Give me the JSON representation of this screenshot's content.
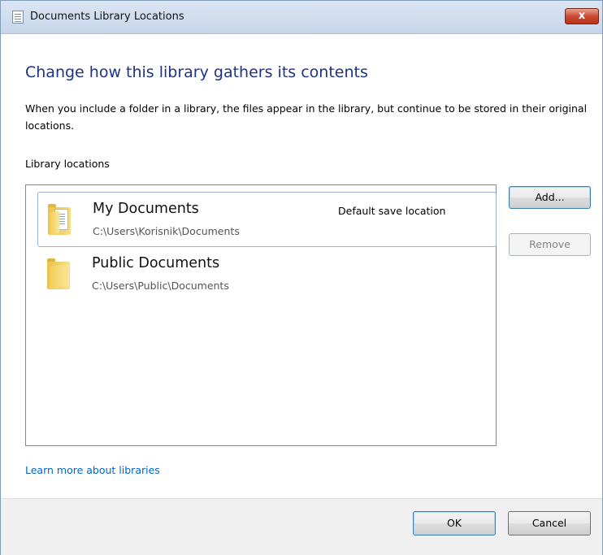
{
  "window": {
    "title": "Documents Library Locations",
    "close_symbol": "x"
  },
  "heading": "Change how this library gathers its contents",
  "description": "When you include a folder in a library, the files appear in the library, but continue to be stored in their original locations.",
  "locations_label": "Library locations",
  "locations": [
    {
      "name": "My Documents",
      "path": "C:\\Users\\Korisnik\\Documents",
      "badge": "Default save location",
      "icon": "documents-folder-icon",
      "selected": true
    },
    {
      "name": "Public Documents",
      "path": "C:\\Users\\Public\\Documents",
      "badge": "",
      "icon": "folder-icon",
      "selected": false
    }
  ],
  "buttons": {
    "add": "Add...",
    "remove": "Remove",
    "ok": "OK",
    "cancel": "Cancel"
  },
  "learn_more_link": "Learn more about libraries",
  "colors": {
    "heading": "#1e3287",
    "link": "#0066cc",
    "close_button": "#c9452d"
  }
}
